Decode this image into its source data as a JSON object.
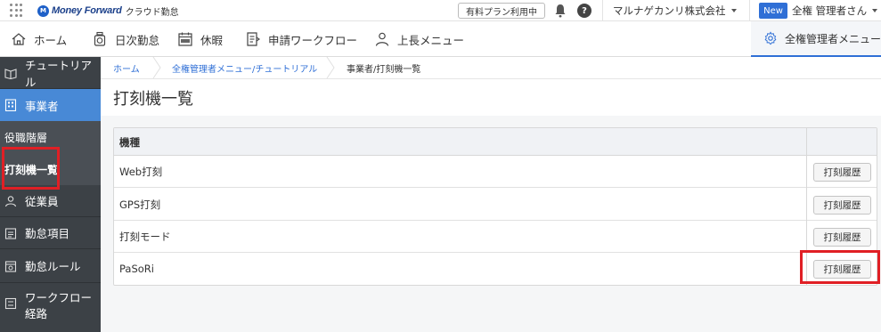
{
  "topbar": {
    "logo_mark": "M",
    "logo_text": "Money Forward",
    "logo_sub": "クラウド勤怠",
    "plan_badge": "有料プラン利用中",
    "help_label": "?",
    "company": "マルナゲカンリ株式会社",
    "new_badge": "New",
    "user": "全権 管理者さん"
  },
  "nav": {
    "home": "ホーム",
    "daily": "日次勤怠",
    "leave": "休暇",
    "workflow": "申請ワークフロー",
    "manager": "上長メニュー",
    "admin": "全権管理者メニュー"
  },
  "sidebar": {
    "items": [
      {
        "label": "チュートリアル",
        "icon": "tutorial-icon"
      },
      {
        "label": "事業者",
        "icon": "building-icon"
      },
      {
        "label": "役職階層"
      },
      {
        "label": "打刻機一覧"
      },
      {
        "label": "従業員",
        "icon": "person-icon"
      },
      {
        "label": "勤怠項目",
        "icon": "calendar-list-icon"
      },
      {
        "label": "勤怠ルール",
        "icon": "calendar-rule-icon"
      },
      {
        "label": "ワークフロー",
        "label2": "経路",
        "icon": "workflow-icon"
      }
    ]
  },
  "breadcrumb": {
    "home": "ホーム",
    "admin_tutorial": "全権管理者メニュー/チュートリアル",
    "current": "事業者/打刻機一覧"
  },
  "page": {
    "title": "打刻機一覧"
  },
  "table": {
    "header": "機種",
    "button_label": "打刻履歴",
    "rows": [
      {
        "name": "Web打刻"
      },
      {
        "name": "GPS打刻"
      },
      {
        "name": "打刻モード"
      },
      {
        "name": "PaSoRi"
      }
    ]
  },
  "colors": {
    "accent": "#2f6fd6",
    "sidebar_bg": "#3c4146",
    "sidebar_active": "#4889d6",
    "highlight": "#e01f25"
  }
}
